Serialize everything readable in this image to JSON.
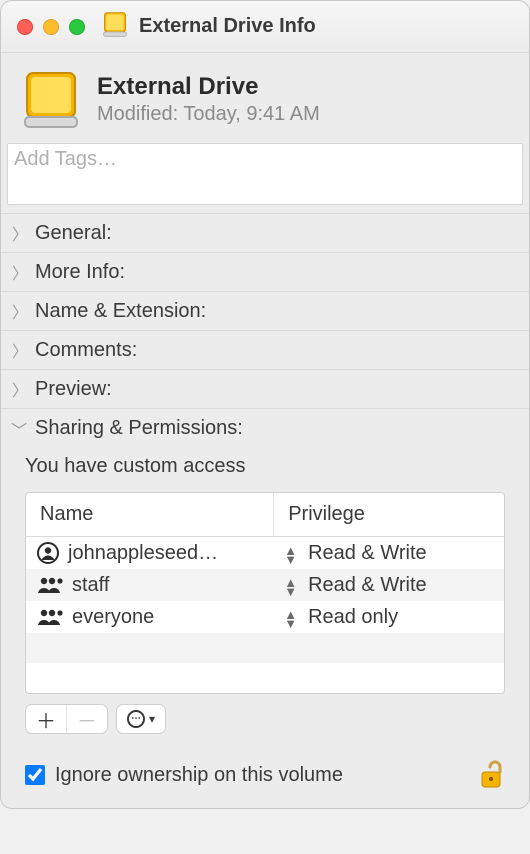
{
  "window": {
    "title": "External Drive Info"
  },
  "summary": {
    "name": "External Drive",
    "modified_label": "Modified:",
    "modified_value": "Today, 9:41 AM"
  },
  "tags": {
    "placeholder": "Add Tags…"
  },
  "sections": {
    "general": "General:",
    "more_info": "More Info:",
    "name_ext": "Name & Extension:",
    "comments": "Comments:",
    "preview": "Preview:",
    "sharing": "Sharing & Permissions:"
  },
  "sharing": {
    "access_text": "You have custom access",
    "columns": {
      "name": "Name",
      "privilege": "Privilege"
    },
    "rows": [
      {
        "user": "johnappleseed…",
        "privilege": "Read & Write",
        "icon": "user"
      },
      {
        "user": "staff",
        "privilege": "Read & Write",
        "icon": "group"
      },
      {
        "user": "everyone",
        "privilege": "Read only",
        "icon": "group"
      }
    ],
    "ignore_label": "Ignore ownership on this volume",
    "ignore_checked": true
  },
  "icons": {
    "drive": "external-drive-icon",
    "lock": "lock-open-icon"
  }
}
